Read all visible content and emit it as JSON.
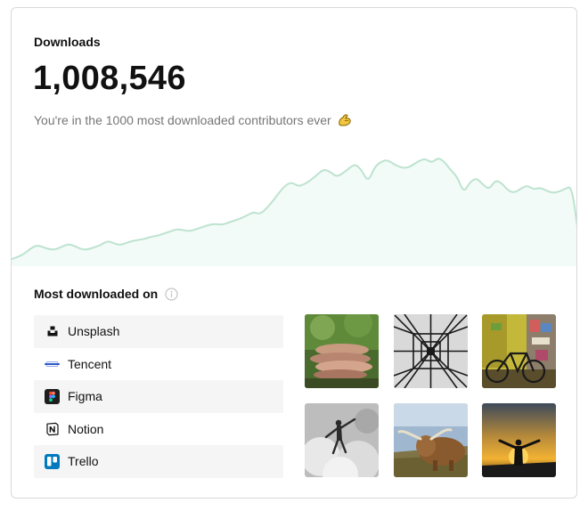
{
  "card": {
    "label": "Downloads",
    "total": "1,008,546",
    "subtitle": "You're in the 1000 most downloaded contributors ever",
    "subtitle_icon": "flexed-biceps-icon"
  },
  "trend": {
    "series": [
      86,
      88,
      91,
      96,
      99,
      97,
      95,
      95,
      98,
      100,
      98,
      95,
      95,
      97,
      99,
      103,
      101,
      99,
      101,
      103,
      104,
      105,
      107,
      108,
      110,
      112,
      114,
      113,
      112,
      114,
      116,
      118,
      119,
      118,
      120,
      122,
      124,
      127,
      130,
      128,
      133,
      140,
      148,
      155,
      158,
      154,
      156,
      160,
      165,
      170,
      168,
      163,
      166,
      171,
      175,
      169,
      158,
      172,
      177,
      179,
      175,
      172,
      171,
      174,
      178,
      180,
      176,
      181,
      177,
      169,
      163,
      148,
      158,
      162,
      156,
      151,
      160,
      157,
      150,
      148,
      152,
      155,
      151,
      153,
      150,
      148,
      149,
      152,
      154,
      110
    ],
    "colors": {
      "line": "#bde3cf",
      "fill": "#f3fbf8"
    }
  },
  "most_downloaded": {
    "title": "Most downloaded on",
    "info_icon": "info-icon",
    "platforms": [
      {
        "name": "Unsplash",
        "icon": "unsplash-logo-icon"
      },
      {
        "name": "Tencent",
        "icon": "tencent-logo-icon"
      },
      {
        "name": "Figma",
        "icon": "figma-logo-icon"
      },
      {
        "name": "Notion",
        "icon": "notion-logo-icon"
      },
      {
        "name": "Trello",
        "icon": "trello-logo-icon"
      }
    ],
    "photos": [
      {
        "subject": "stacked-hands-photo"
      },
      {
        "subject": "power-tower-photo"
      },
      {
        "subject": "bicycle-wall-photo"
      },
      {
        "subject": "jumping-person-photo"
      },
      {
        "subject": "highland-cow-photo"
      },
      {
        "subject": "sunset-silhouette-photo"
      }
    ]
  }
}
